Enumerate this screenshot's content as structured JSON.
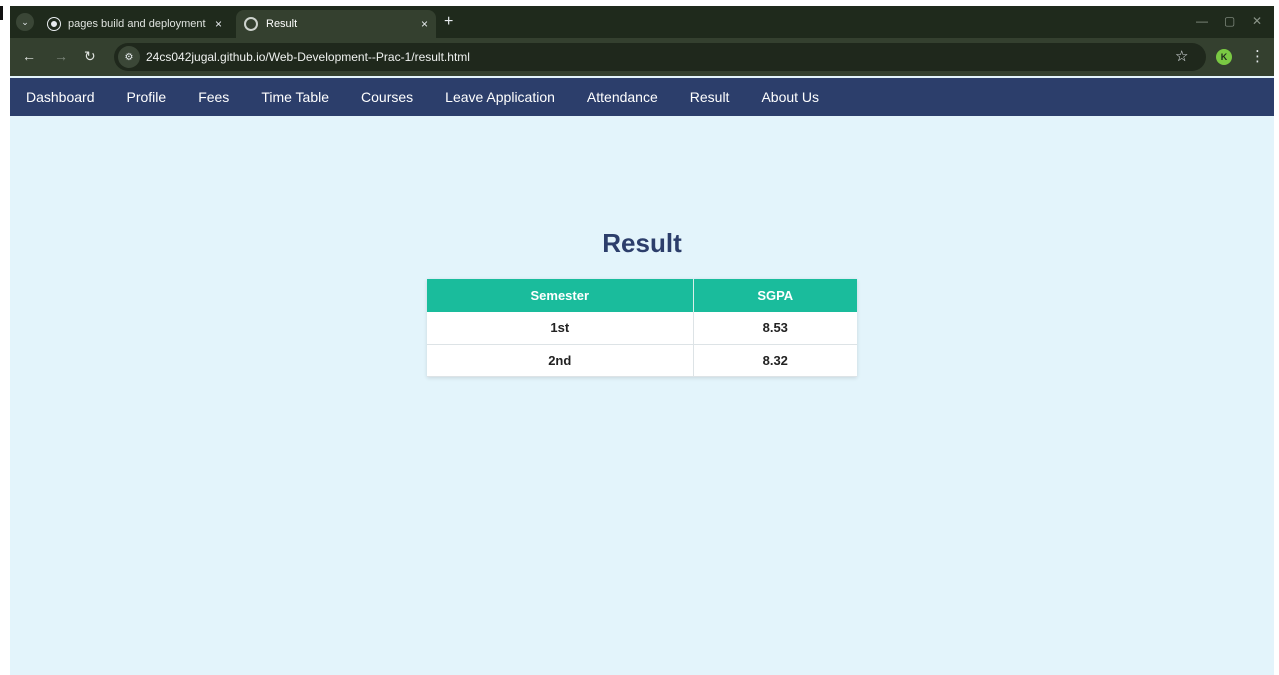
{
  "browser": {
    "tabs": [
      {
        "title": "pages build and deployment · ",
        "close": "×",
        "active": false
      },
      {
        "title": "Result",
        "close": "×",
        "active": true
      }
    ],
    "new_tab": "+",
    "url": "24cs042jugal.github.io/Web-Development--Prac-1/result.html",
    "profile_initial": "K"
  },
  "nav": {
    "items": [
      "Dashboard",
      "Profile",
      "Fees",
      "Time Table",
      "Courses",
      "Leave Application",
      "Attendance",
      "Result",
      "About Us"
    ]
  },
  "page": {
    "heading": "Result",
    "table": {
      "headers": [
        "Semester",
        "SGPA"
      ],
      "rows": [
        [
          "1st",
          "8.53"
        ],
        [
          "2nd",
          "8.32"
        ]
      ]
    }
  },
  "colors": {
    "nav_bg": "#2c3e6b",
    "page_bg": "#e3f4fb",
    "table_header": "#1abc9c",
    "heading": "#2c3e6b"
  }
}
